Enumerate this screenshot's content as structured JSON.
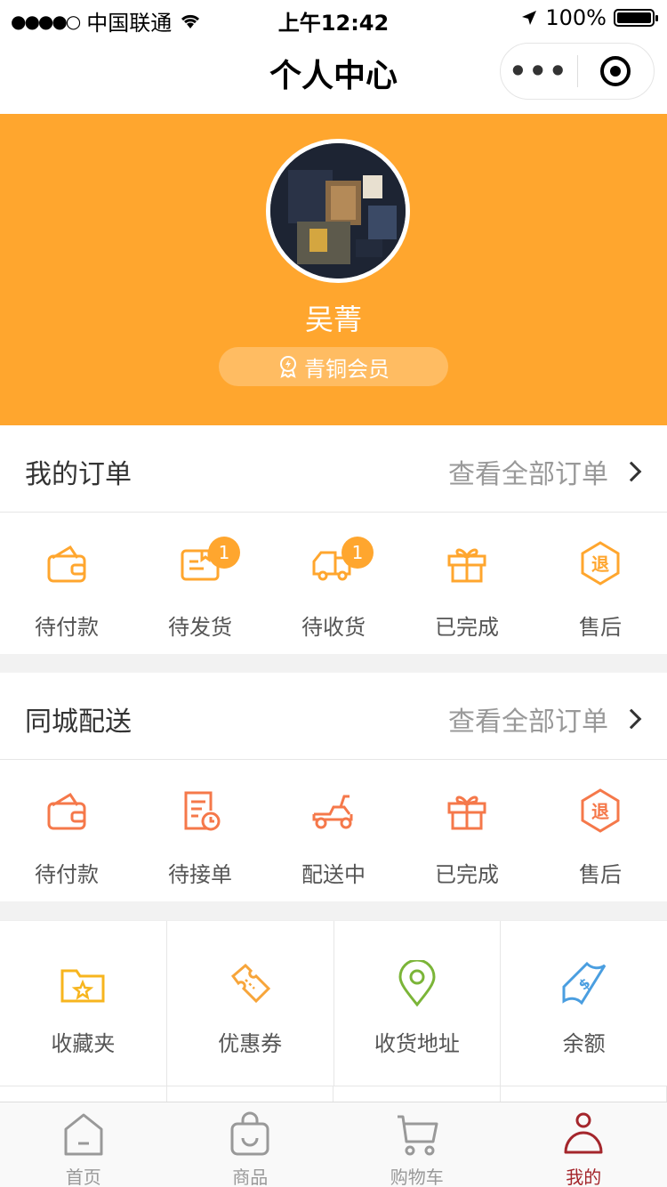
{
  "status_bar": {
    "carrier": "中国联通",
    "time": "上午12:42",
    "battery": "100%"
  },
  "navbar": {
    "title": "个人中心",
    "more_label": "•••"
  },
  "profile": {
    "username": "吴菁",
    "member_level": "青铜会员"
  },
  "orders": {
    "title": "我的订单",
    "view_all": "查看全部订单",
    "items": [
      {
        "label": "待付款",
        "icon": "wallet-icon",
        "badge": ""
      },
      {
        "label": "待发货",
        "icon": "package-icon",
        "badge": "1"
      },
      {
        "label": "待收货",
        "icon": "truck-icon",
        "badge": "1"
      },
      {
        "label": "已完成",
        "icon": "gift-icon",
        "badge": ""
      },
      {
        "label": "售后",
        "icon": "refund-icon",
        "badge": ""
      }
    ]
  },
  "local_delivery": {
    "title": "同城配送",
    "view_all": "查看全部订单",
    "items": [
      {
        "label": "待付款",
        "icon": "wallet-icon"
      },
      {
        "label": "待接单",
        "icon": "order-clock-icon"
      },
      {
        "label": "配送中",
        "icon": "scooter-icon"
      },
      {
        "label": "已完成",
        "icon": "gift-icon"
      },
      {
        "label": "售后",
        "icon": "refund-icon"
      }
    ]
  },
  "tools": {
    "items": [
      {
        "label": "收藏夹",
        "icon": "favorites-folder-icon"
      },
      {
        "label": "优惠券",
        "icon": "coupon-icon"
      },
      {
        "label": "收货地址",
        "icon": "location-pin-icon"
      },
      {
        "label": "余额",
        "icon": "balance-icon"
      }
    ]
  },
  "tabbar": {
    "items": [
      {
        "label": "首页",
        "icon": "home-icon"
      },
      {
        "label": "商品",
        "icon": "shopping-bag-icon"
      },
      {
        "label": "购物车",
        "icon": "cart-icon"
      },
      {
        "label": "我的",
        "icon": "user-icon"
      }
    ],
    "active_index": 3
  },
  "colors": {
    "accent": "#ffa62e",
    "delivery_icon": "#f5784a",
    "active_tab": "#a4262c"
  }
}
